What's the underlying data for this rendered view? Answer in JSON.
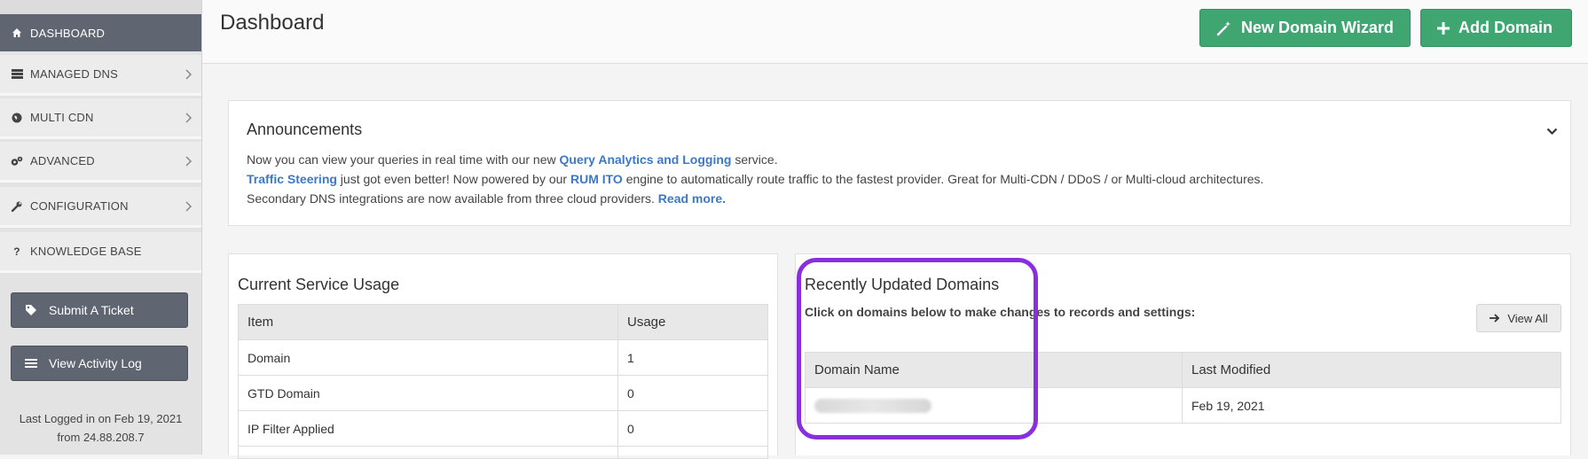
{
  "sidebar": {
    "items": [
      {
        "label": "DASHBOARD",
        "icon": "home-icon",
        "active": true
      },
      {
        "label": "MANAGED DNS",
        "icon": "server-icon"
      },
      {
        "label": "MULTI CDN",
        "icon": "globe-icon"
      },
      {
        "label": "ADVANCED",
        "icon": "gears-icon"
      },
      {
        "label": "CONFIGURATION",
        "icon": "wrench-icon"
      },
      {
        "label": "KNOWLEDGE BASE",
        "icon": "question-icon"
      }
    ],
    "buttons": {
      "submit_ticket": "Submit A Ticket",
      "activity_log": "View Activity Log"
    },
    "last_login_line1": "Last Logged in on Feb 19, 2021",
    "last_login_line2": "from 24.88.208.7"
  },
  "header": {
    "title": "Dashboard",
    "new_domain_wizard": "New Domain Wizard",
    "add_domain": "Add Domain"
  },
  "announcements": {
    "title": "Announcements",
    "line1_pre": "Now you can view your queries in real time with our new ",
    "line1_link": "Query Analytics and Logging",
    "line1_post": " service.",
    "line2_link1": "Traffic Steering",
    "line2_mid": " just got even better! Now powered by our ",
    "line2_link2": "RUM ITO",
    "line2_post": " engine to automatically route traffic to the fastest provider. Great for Multi-CDN / DDoS / or Multi-cloud architectures.",
    "line3_pre": "Secondary DNS integrations are now available from three cloud providers. ",
    "line3_link": "Read more."
  },
  "usage": {
    "title": "Current Service Usage",
    "headers": {
      "item": "Item",
      "usage": "Usage"
    },
    "rows": [
      {
        "item": "Domain",
        "usage": "1"
      },
      {
        "item": "GTD Domain",
        "usage": "0"
      },
      {
        "item": "IP Filter Applied",
        "usage": "0"
      }
    ]
  },
  "recent": {
    "title": "Recently Updated Domains",
    "subtitle": "Click on domains below to make changes to records and settings:",
    "view_all": "View All",
    "headers": {
      "domain": "Domain Name",
      "modified": "Last Modified"
    },
    "rows": [
      {
        "modified": "Feb 19, 2021"
      }
    ]
  },
  "colors": {
    "accent_green": "#3fa672",
    "sidebar_active": "#5f6671",
    "link_blue": "#3c78c8",
    "highlight_purple": "#8a2fe0"
  }
}
